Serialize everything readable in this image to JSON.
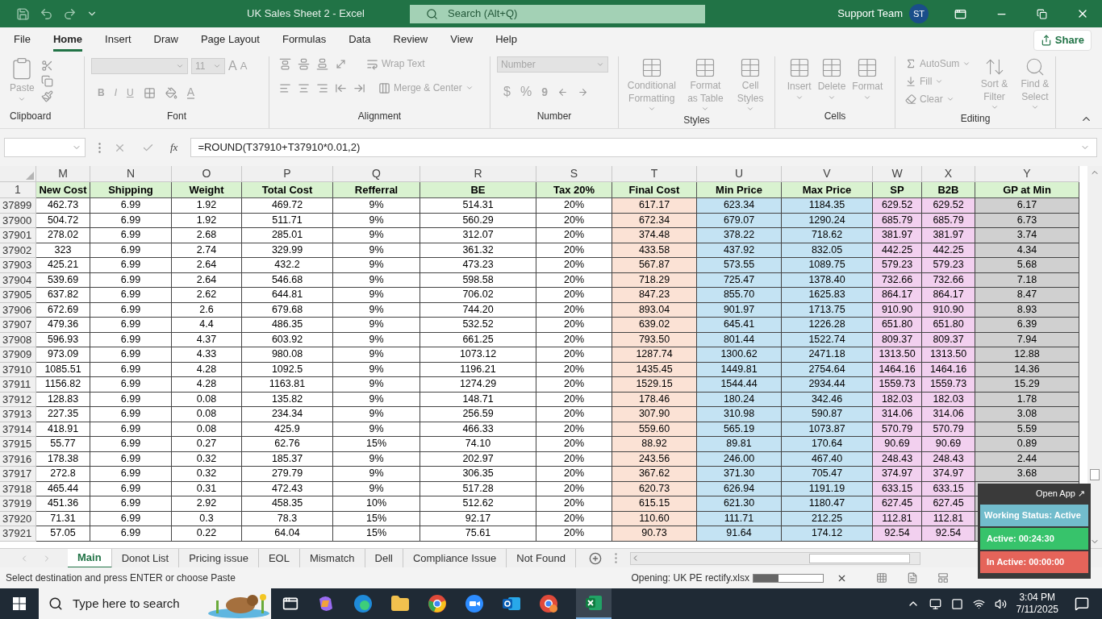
{
  "window": {
    "title": "UK Sales Sheet 2  -  Excel",
    "search_placeholder": "Search (Alt+Q)",
    "user_name": "Support Team",
    "user_initials": "ST"
  },
  "ribbon_tabs": [
    {
      "label": "File",
      "selected": false
    },
    {
      "label": "Home",
      "selected": true
    },
    {
      "label": "Insert",
      "selected": false
    },
    {
      "label": "Draw",
      "selected": false
    },
    {
      "label": "Page Layout",
      "selected": false
    },
    {
      "label": "Formulas",
      "selected": false
    },
    {
      "label": "Data",
      "selected": false
    },
    {
      "label": "Review",
      "selected": false
    },
    {
      "label": "View",
      "selected": false
    },
    {
      "label": "Help",
      "selected": false
    }
  ],
  "share_button": "Share",
  "ribbon": {
    "disabled": true,
    "clipboard": {
      "label": "Clipboard",
      "paste": "Paste"
    },
    "font": {
      "label": "Font",
      "size": "11",
      "grow": "A",
      "shrink": "A",
      "bold": "B",
      "italic": "I",
      "underline": "U",
      "font_color": "A"
    },
    "alignment": {
      "label": "Alignment",
      "wrap": "Wrap Text",
      "merge": "Merge & Center"
    },
    "number": {
      "label": "Number",
      "format": "Number",
      "currency": "$",
      "percent": "%",
      "comma": "9"
    },
    "styles": {
      "label": "Styles",
      "buttons": [
        "Conditional Formatting",
        "Format as Table",
        "Cell Styles"
      ]
    },
    "cells": {
      "label": "Cells",
      "buttons": [
        "Insert",
        "Delete",
        "Format"
      ]
    },
    "editing": {
      "label": "Editing",
      "autosum": "AutoSum",
      "fill": "Fill",
      "clear": "Clear",
      "buttons": [
        "Sort & Filter",
        "Find & Select"
      ]
    }
  },
  "formula_bar": {
    "fx": "fx",
    "formula": "=ROUND(T37910+T37910*0.01,2)"
  },
  "header_row_number": "1",
  "columns": [
    {
      "letter": "M",
      "header": "New Cost"
    },
    {
      "letter": "N",
      "header": "Shipping"
    },
    {
      "letter": "O",
      "header": "Weight"
    },
    {
      "letter": "P",
      "header": "Total Cost"
    },
    {
      "letter": "Q",
      "header": "Refferral"
    },
    {
      "letter": "R",
      "header": "BE"
    },
    {
      "letter": "S",
      "header": "Tax 20%"
    },
    {
      "letter": "T",
      "header": "Final Cost",
      "color": "#fbe2d5"
    },
    {
      "letter": "U",
      "header": "Min Price",
      "color": "#c4e3f3"
    },
    {
      "letter": "V",
      "header": "Max Price",
      "color": "#c4e3f3"
    },
    {
      "letter": "W",
      "header": "SP",
      "color": "#f2d0ef"
    },
    {
      "letter": "X",
      "header": "B2B",
      "color": "#f2d0ef"
    },
    {
      "letter": "Y",
      "header": "GP at Min",
      "color": "#d0d0d0"
    }
  ],
  "rows": [
    {
      "num": "37899",
      "cells": [
        "462.73",
        "6.99",
        "1.92",
        "469.72",
        "9%",
        "514.31",
        "20%",
        "617.17",
        "623.34",
        "1184.35",
        "629.52",
        "629.52",
        "6.17"
      ]
    },
    {
      "num": "37900",
      "cells": [
        "504.72",
        "6.99",
        "1.92",
        "511.71",
        "9%",
        "560.29",
        "20%",
        "672.34",
        "679.07",
        "1290.24",
        "685.79",
        "685.79",
        "6.73"
      ]
    },
    {
      "num": "37901",
      "cells": [
        "278.02",
        "6.99",
        "2.68",
        "285.01",
        "9%",
        "312.07",
        "20%",
        "374.48",
        "378.22",
        "718.62",
        "381.97",
        "381.97",
        "3.74"
      ]
    },
    {
      "num": "37902",
      "cells": [
        "323",
        "6.99",
        "2.74",
        "329.99",
        "9%",
        "361.32",
        "20%",
        "433.58",
        "437.92",
        "832.05",
        "442.25",
        "442.25",
        "4.34"
      ]
    },
    {
      "num": "37903",
      "cells": [
        "425.21",
        "6.99",
        "2.64",
        "432.2",
        "9%",
        "473.23",
        "20%",
        "567.87",
        "573.55",
        "1089.75",
        "579.23",
        "579.23",
        "5.68"
      ]
    },
    {
      "num": "37904",
      "cells": [
        "539.69",
        "6.99",
        "2.64",
        "546.68",
        "9%",
        "598.58",
        "20%",
        "718.29",
        "725.47",
        "1378.40",
        "732.66",
        "732.66",
        "7.18"
      ]
    },
    {
      "num": "37905",
      "cells": [
        "637.82",
        "6.99",
        "2.62",
        "644.81",
        "9%",
        "706.02",
        "20%",
        "847.23",
        "855.70",
        "1625.83",
        "864.17",
        "864.17",
        "8.47"
      ]
    },
    {
      "num": "37906",
      "cells": [
        "672.69",
        "6.99",
        "2.6",
        "679.68",
        "9%",
        "744.20",
        "20%",
        "893.04",
        "901.97",
        "1713.75",
        "910.90",
        "910.90",
        "8.93"
      ]
    },
    {
      "num": "37907",
      "cells": [
        "479.36",
        "6.99",
        "4.4",
        "486.35",
        "9%",
        "532.52",
        "20%",
        "639.02",
        "645.41",
        "1226.28",
        "651.80",
        "651.80",
        "6.39"
      ]
    },
    {
      "num": "37908",
      "cells": [
        "596.93",
        "6.99",
        "4.37",
        "603.92",
        "9%",
        "661.25",
        "20%",
        "793.50",
        "801.44",
        "1522.74",
        "809.37",
        "809.37",
        "7.94"
      ]
    },
    {
      "num": "37909",
      "cells": [
        "973.09",
        "6.99",
        "4.33",
        "980.08",
        "9%",
        "1073.12",
        "20%",
        "1287.74",
        "1300.62",
        "2471.18",
        "1313.50",
        "1313.50",
        "12.88"
      ]
    },
    {
      "num": "37910",
      "cells": [
        "1085.51",
        "6.99",
        "4.28",
        "1092.5",
        "9%",
        "1196.21",
        "20%",
        "1435.45",
        "1449.81",
        "2754.64",
        "1464.16",
        "1464.16",
        "14.36"
      ]
    },
    {
      "num": "37911",
      "cells": [
        "1156.82",
        "6.99",
        "4.28",
        "1163.81",
        "9%",
        "1274.29",
        "20%",
        "1529.15",
        "1544.44",
        "2934.44",
        "1559.73",
        "1559.73",
        "15.29"
      ]
    },
    {
      "num": "37912",
      "cells": [
        "128.83",
        "6.99",
        "0.08",
        "135.82",
        "9%",
        "148.71",
        "20%",
        "178.46",
        "180.24",
        "342.46",
        "182.03",
        "182.03",
        "1.78"
      ]
    },
    {
      "num": "37913",
      "cells": [
        "227.35",
        "6.99",
        "0.08",
        "234.34",
        "9%",
        "256.59",
        "20%",
        "307.90",
        "310.98",
        "590.87",
        "314.06",
        "314.06",
        "3.08"
      ]
    },
    {
      "num": "37914",
      "cells": [
        "418.91",
        "6.99",
        "0.08",
        "425.9",
        "9%",
        "466.33",
        "20%",
        "559.60",
        "565.19",
        "1073.87",
        "570.79",
        "570.79",
        "5.59"
      ]
    },
    {
      "num": "37915",
      "cells": [
        "55.77",
        "6.99",
        "0.27",
        "62.76",
        "15%",
        "74.10",
        "20%",
        "88.92",
        "89.81",
        "170.64",
        "90.69",
        "90.69",
        "0.89"
      ]
    },
    {
      "num": "37916",
      "cells": [
        "178.38",
        "6.99",
        "0.32",
        "185.37",
        "9%",
        "202.97",
        "20%",
        "243.56",
        "246.00",
        "467.40",
        "248.43",
        "248.43",
        "2.44"
      ]
    },
    {
      "num": "37917",
      "cells": [
        "272.8",
        "6.99",
        "0.32",
        "279.79",
        "9%",
        "306.35",
        "20%",
        "367.62",
        "371.30",
        "705.47",
        "374.97",
        "374.97",
        "3.68"
      ]
    },
    {
      "num": "37918",
      "cells": [
        "465.44",
        "6.99",
        "0.31",
        "472.43",
        "9%",
        "517.28",
        "20%",
        "620.73",
        "626.94",
        "1191.19",
        "633.15",
        "633.15"
      ]
    },
    {
      "num": "37919",
      "cells": [
        "451.36",
        "6.99",
        "2.92",
        "458.35",
        "10%",
        "512.62",
        "20%",
        "615.15",
        "621.30",
        "1180.47",
        "627.45",
        "627.45"
      ]
    },
    {
      "num": "37920",
      "cells": [
        "71.31",
        "6.99",
        "0.3",
        "78.3",
        "15%",
        "92.17",
        "20%",
        "110.60",
        "111.71",
        "212.25",
        "112.81",
        "112.81"
      ]
    },
    {
      "num": "37921",
      "cells": [
        "57.05",
        "6.99",
        "0.22",
        "64.04",
        "15%",
        "75.61",
        "20%",
        "90.73",
        "91.64",
        "174.12",
        "92.54",
        "92.54"
      ]
    }
  ],
  "sheet_tabs": [
    {
      "label": "Main",
      "selected": true
    },
    {
      "label": "Donot List",
      "selected": false
    },
    {
      "label": "Pricing issue",
      "selected": false
    },
    {
      "label": "EOL",
      "selected": false
    },
    {
      "label": "Mismatch",
      "selected": false
    },
    {
      "label": "Dell",
      "selected": false
    },
    {
      "label": "Compliance Issue",
      "selected": false
    },
    {
      "label": "Not Found",
      "selected": false
    }
  ],
  "status_bar": {
    "message": "Select destination and press ENTER or choose Paste",
    "opening": "Opening: UK PE rectify.xlsx",
    "progress": {
      "level": 0.36
    }
  },
  "tracker": {
    "open_app": "Open App ↗",
    "status": "Working Status: Active",
    "active": "Active: 00:24:30",
    "inactive": "In Active: 00:00:00"
  },
  "taskbar": {
    "search_placeholder": "Type here to search",
    "time": "3:04 PM",
    "date": "7/11/2025"
  }
}
